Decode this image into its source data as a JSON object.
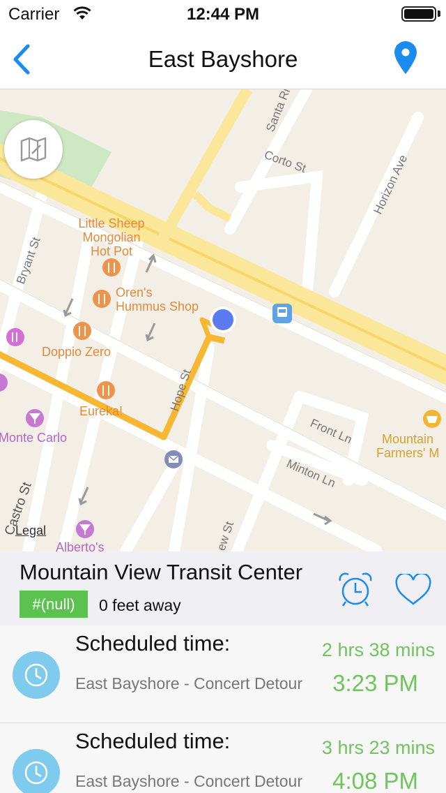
{
  "status_bar": {
    "carrier": "Carrier",
    "time": "12:44 PM"
  },
  "nav": {
    "title": "East Bayshore"
  },
  "map": {
    "legal": "Legal",
    "pois": {
      "little_sheep": [
        "Little Sheep",
        "Mongolian",
        "Hot Pot"
      ],
      "orens": [
        "Oren's",
        "Hummus Shop"
      ],
      "doppio": "Doppio Zero",
      "eureka": "Eureka!",
      "monte_carlo": "Monte Carlo",
      "alberto": "Alberto's",
      "farmers": [
        "Mountain",
        "Farmers' M"
      ]
    },
    "streets": {
      "santa_rita": "Santa Ri",
      "corto": "Corto St",
      "horizon": "Horizon Ave",
      "bryant": "Bryant St",
      "hope": "Hope St",
      "front": "Front Ln",
      "minton": "Minton Ln",
      "castro": "Castro St",
      "view": "ew St"
    }
  },
  "stop": {
    "name": "Mountain View Transit Center",
    "route_badge": "#(null)",
    "distance": "0 feet away"
  },
  "arrivals": [
    {
      "label": "Scheduled time:",
      "route": "East Bayshore - Concert Detour",
      "eta": "2 hrs 38 mins",
      "time": "3:23 PM"
    },
    {
      "label": "Scheduled time:",
      "route": "East Bayshore - Concert Detour",
      "eta": "3 hrs 23 mins",
      "time": "4:08 PM"
    }
  ],
  "colors": {
    "accent": "#1a8cf0",
    "route_line": "#f7b733",
    "badge": "#5bc14f",
    "eta_green": "#6fc45e",
    "clock_blue": "#7ecbee"
  }
}
